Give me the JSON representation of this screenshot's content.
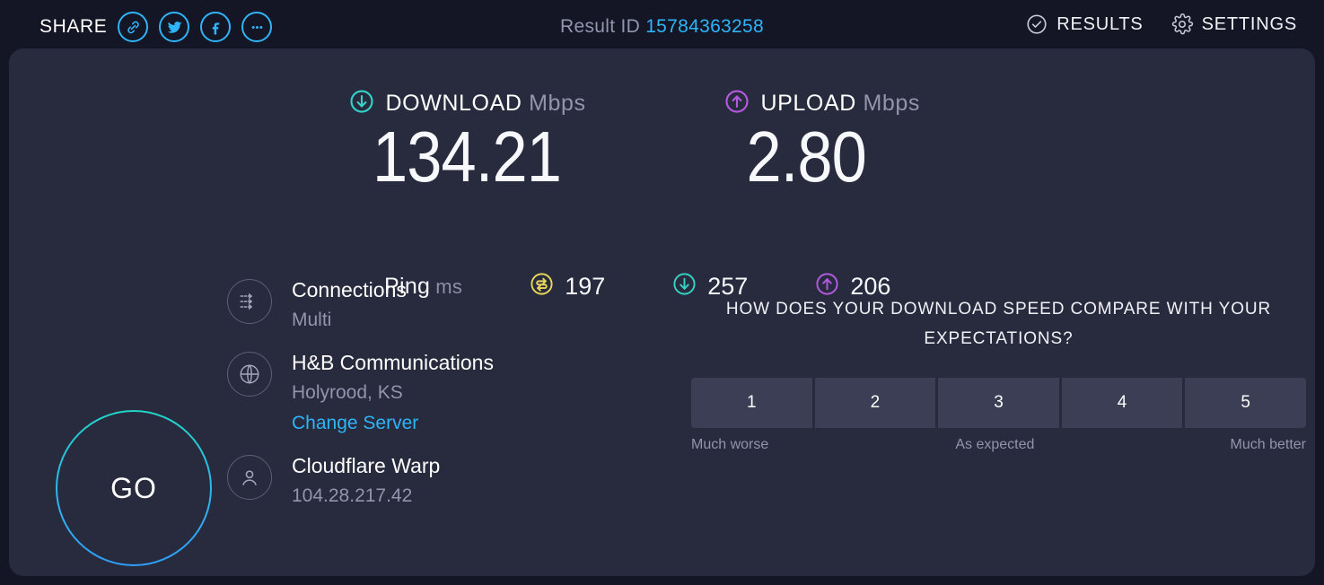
{
  "topbar": {
    "share_label": "SHARE",
    "share_icons": [
      {
        "name": "link-icon",
        "title": "Copy link"
      },
      {
        "name": "twitter-icon",
        "title": "Twitter"
      },
      {
        "name": "facebook-icon",
        "title": "Facebook"
      },
      {
        "name": "more-icon",
        "title": "More"
      }
    ],
    "result_id_label": "Result ID",
    "result_id_value": "15784363258",
    "results_label": "RESULTS",
    "settings_label": "SETTINGS"
  },
  "speeds": {
    "download": {
      "label": "DOWNLOAD",
      "unit": "Mbps",
      "value": "134.21",
      "color": "#35d2c6",
      "icon": "download-arrow-icon"
    },
    "upload": {
      "label": "UPLOAD",
      "unit": "Mbps",
      "value": "2.80",
      "color": "#b45ae0",
      "icon": "upload-arrow-icon"
    }
  },
  "ping": {
    "label": "Ping",
    "unit": "ms",
    "idle": {
      "value": "197",
      "color": "#e8d65a",
      "icon": "idle-latency-icon"
    },
    "download": {
      "value": "257",
      "color": "#35d2c6",
      "icon": "download-latency-icon"
    },
    "upload": {
      "value": "206",
      "color": "#b45ae0",
      "icon": "upload-latency-icon"
    }
  },
  "go_button": {
    "label": "GO"
  },
  "info": {
    "connections": {
      "icon": "multi-connections-icon",
      "title": "Connections",
      "subtitle": "Multi"
    },
    "server": {
      "icon": "globe-icon",
      "title": "H&B Communications",
      "location": "Holyrood, KS",
      "change_link": "Change Server"
    },
    "client": {
      "icon": "person-icon",
      "title": "Cloudflare Warp",
      "ip": "104.28.217.42"
    }
  },
  "rating": {
    "question": "HOW DOES YOUR DOWNLOAD SPEED COMPARE WITH YOUR EXPECTATIONS?",
    "options": [
      "1",
      "2",
      "3",
      "4",
      "5"
    ],
    "legend_low": "Much worse",
    "legend_mid": "As expected",
    "legend_high": "Much better"
  }
}
